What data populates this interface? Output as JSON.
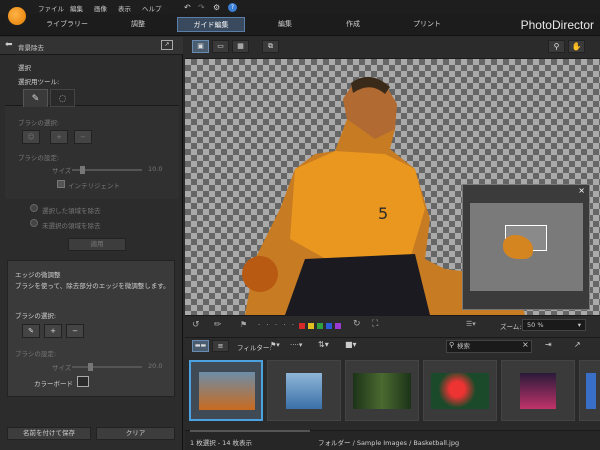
{
  "menu": {
    "items": [
      "ファイル",
      "編集",
      "画像",
      "表示",
      "ヘルプ"
    ]
  },
  "tabs": [
    "ライブラリー",
    "調整",
    "ガイド編集",
    "編集",
    "作成",
    "プリント"
  ],
  "active_tab": "ガイド編集",
  "brand": "PhotoDirector",
  "panel": {
    "header_title": "背景除去",
    "selection_title": "選択",
    "selection_tool_label": "選択用ツール:",
    "brush_select_label": "ブラシの選択:",
    "brush_settings_label": "ブラシの設定:",
    "size_label": "サイズ",
    "size_value": "10.0",
    "intelligent_label": "インテリジェント",
    "option_remove_selected": "選択した領域を除去",
    "option_remove_unselected": "未選択の領域を除去",
    "apply_button": "適用",
    "edge_section": {
      "title": "エッジの微調整",
      "description": "ブラシを使って、除去部分のエッジを微調整します。",
      "brush_select_label": "ブラシの選択:",
      "brush_settings_label": "ブラシの設定:",
      "size_label": "サイズ",
      "size_value": "20.0",
      "color_board_label": "カラーボード"
    },
    "save_as_button": "名前を付けて保存",
    "clear_button": "クリア"
  },
  "toolbar": {
    "filter_label": "フィルター:",
    "zoom_label": "ズーム:",
    "zoom_value": "50 %"
  },
  "search": {
    "placeholder": "検索"
  },
  "status": {
    "selection": "1 枚選択 - 14 枚表示",
    "path": "フォルダー / Sample Images / Basketball.jpg"
  },
  "colors": {
    "accent": "#4aa3e0",
    "brand_orange": "#e98a00",
    "active_tab_bg": "#3a4a5e"
  },
  "filter_colors": [
    "#d42a2a",
    "#e0c020",
    "#2fa040",
    "#2a5ad8",
    "#9a3ad0"
  ]
}
